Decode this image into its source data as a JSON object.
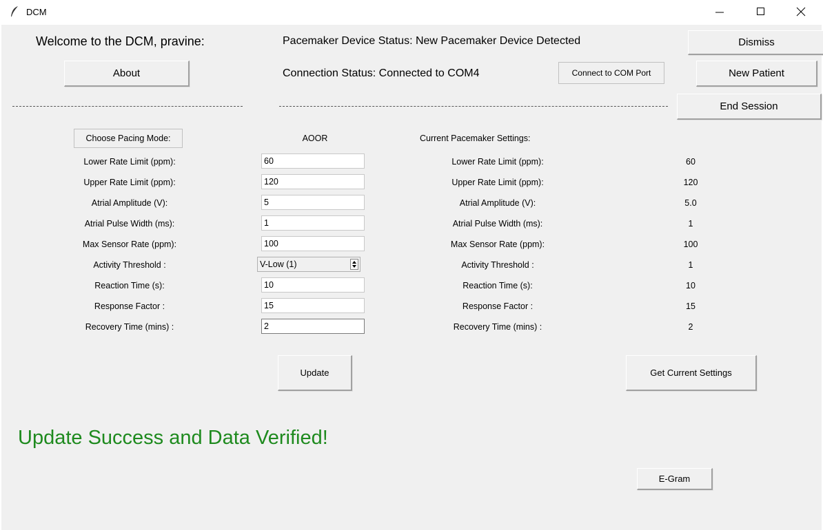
{
  "window": {
    "title": "DCM",
    "icons": {
      "app": "feather-icon",
      "minimize": "minimize-icon",
      "maximize": "maximize-icon",
      "close": "close-icon"
    }
  },
  "header": {
    "welcome": "Welcome to the DCM, pravine:",
    "device_status": "Pacemaker Device Status: New Pacemaker Device Detected",
    "connection_status": "Connection Status: Connected to COM4",
    "about_button": "About",
    "connect_button": "Connect to COM Port",
    "dismiss_button": "Dismiss",
    "new_patient_button": "New Patient",
    "end_session_button": "End Session"
  },
  "pacing": {
    "choose_mode_button": "Choose Pacing Mode:",
    "current_mode": "AOOR",
    "current_settings_title": "Current Pacemaker Settings:"
  },
  "params": [
    {
      "label": "Lower Rate Limit (ppm):",
      "input": "60",
      "current": "60"
    },
    {
      "label": "Upper Rate Limit (ppm):",
      "input": "120",
      "current": "120"
    },
    {
      "label": "Atrial Amplitude (V):",
      "input": "5",
      "current": "5.0"
    },
    {
      "label": "Atrial Pulse Width (ms):",
      "input": "1",
      "current": "1"
    },
    {
      "label": "Max Sensor Rate (ppm):",
      "input": "100",
      "current": "100"
    },
    {
      "label": "Activity Threshold :",
      "input": "V-Low (1)",
      "current": "1"
    },
    {
      "label": "Reaction Time (s):",
      "input": "10",
      "current": "10"
    },
    {
      "label": "Response Factor :",
      "input": "15",
      "current": "15"
    },
    {
      "label": "Recovery Time (mins) :",
      "input": "2",
      "current": "2"
    }
  ],
  "actions": {
    "update_button": "Update",
    "get_settings_button": "Get Current Settings",
    "egram_button": "E-Gram"
  },
  "status_message": "Update Success and Data Verified!",
  "colors": {
    "success": "#1e8a1e",
    "background": "#f0f0f0"
  }
}
